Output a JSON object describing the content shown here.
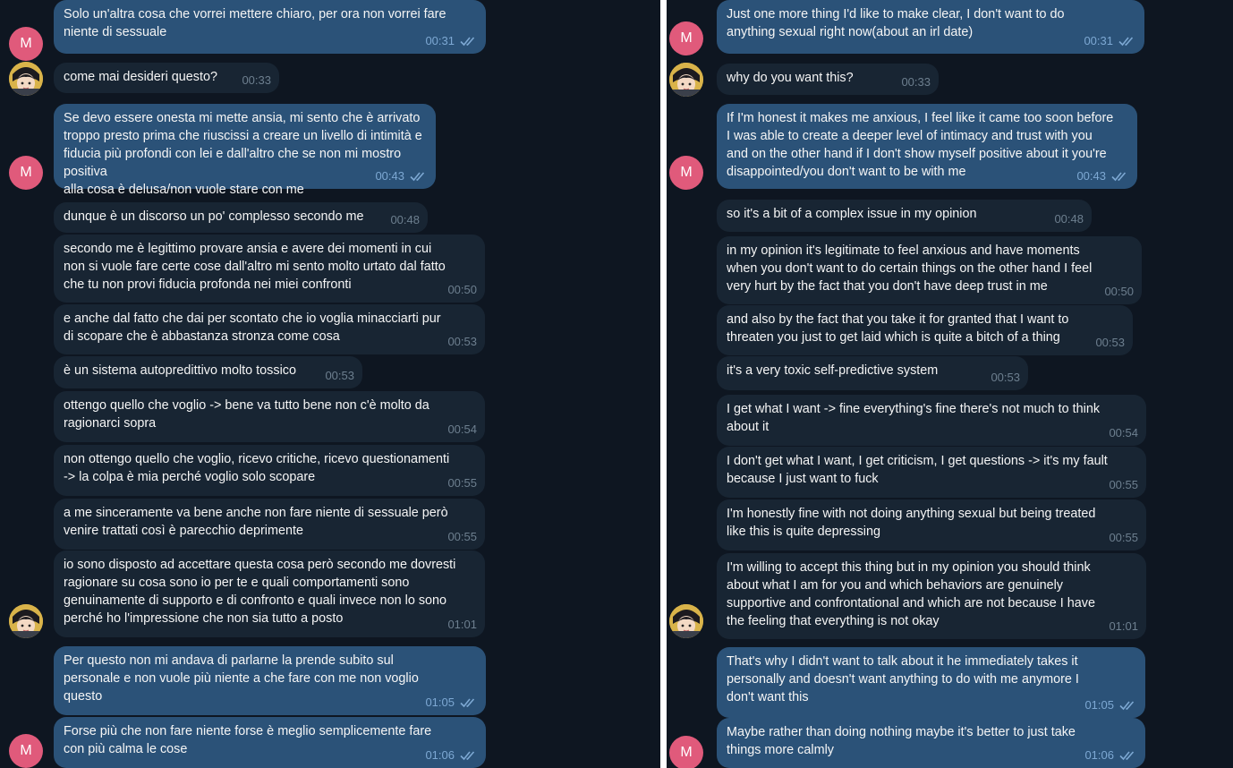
{
  "italian": {
    "messages": [
      {
        "dir": "out",
        "text": "Solo un'altra cosa che vorrei mettere chiaro, per ora non vorrei fare\nniente di sessuale",
        "time": "00:31"
      },
      {
        "dir": "in",
        "text": "come mai desideri questo?",
        "time": "00:33"
      },
      {
        "dir": "out",
        "text": "Se devo essere onesta mi mette ansia, mi sento che è arrivato\ntroppo presto prima che riuscissi a creare un livello di intimità e\nfiducia più profondi con lei e dall'altro che se non mi mostro positiva\nalla cosa è delusa/non vuole stare con me",
        "time": "00:43"
      },
      {
        "dir": "in",
        "text": "dunque è un discorso un po' complesso secondo me",
        "time": "00:48"
      },
      {
        "dir": "in",
        "text": "secondo me è legittimo provare ansia e avere dei momenti in cui\nnon si vuole fare certe cose dall'altro mi sento molto urtato dal fatto\nche tu non provi fiducia profonda nei miei confronti",
        "time": "00:50"
      },
      {
        "dir": "in",
        "text": "e anche dal fatto che dai per scontato che io voglia minacciarti pur\ndi scopare che è abbastanza stronza come cosa",
        "time": "00:53"
      },
      {
        "dir": "in",
        "text": "è un sistema autopredittivo molto tossico",
        "time": "00:53"
      },
      {
        "dir": "in",
        "text": "ottengo quello che voglio -> bene va tutto bene non c'è molto da\nragionarci sopra",
        "time": "00:54"
      },
      {
        "dir": "in",
        "text": "non ottengo quello che voglio, ricevo critiche, ricevo questionamenti\n-> la colpa è mia perché voglio solo scopare",
        "time": "00:55"
      },
      {
        "dir": "in",
        "text": "a me sinceramente va bene anche non fare niente di sessuale però\nvenire trattati così è parecchio deprimente",
        "time": "00:55"
      },
      {
        "dir": "in",
        "text": "io sono disposto ad accettare questa cosa però secondo me dovresti\nragionare su cosa sono io per te e quali comportamenti sono\ngenuinamente di supporto e di confronto e quali invece non lo sono\nperché ho l'impressione che non sia tutto a posto",
        "time": "01:01"
      },
      {
        "dir": "out",
        "text": "Per questo non mi andava di parlarne la prende subito sul\npersonale e non vuole più niente a che fare con me non voglio\nquesto",
        "time": "01:05"
      },
      {
        "dir": "out",
        "text": "Forse più che non fare niente forse è meglio semplicemente fare\ncon più calma le cose",
        "time": "01:06"
      }
    ]
  },
  "english": {
    "messages": [
      {
        "dir": "out",
        "text": "Just one more thing I'd like to make clear, I don't want to do\nanything sexual right now(about an irl date)",
        "time": "00:31"
      },
      {
        "dir": "in",
        "text": "why do you want this?",
        "time": "00:33"
      },
      {
        "dir": "out",
        "text": "If I'm honest it makes me anxious, I feel like it came too soon before\nI was able to create a deeper level of intimacy and trust with you\nand on the other hand if I don't show myself positive about it you're\ndisappointed/you don't want to be with me",
        "time": "00:43"
      },
      {
        "dir": "in",
        "text": "so it's a bit of a complex issue in my opinion",
        "time": "00:48"
      },
      {
        "dir": "in",
        "text": "in my opinion it's legitimate to feel anxious and have moments\nwhen you don't want to do certain things on the other hand I feel\nvery hurt by the fact that you don't have deep trust in me",
        "time": "00:50"
      },
      {
        "dir": "in",
        "text": "and also by the fact that you take it for granted that I want to\nthreaten you just to get laid which is quite a bitch of a thing",
        "time": "00:53"
      },
      {
        "dir": "in",
        "text": "it's a very toxic self-predictive system",
        "time": "00:53"
      },
      {
        "dir": "in",
        "text": "I get what I want -> fine everything's fine there's not much to think\nabout it",
        "time": "00:54"
      },
      {
        "dir": "in",
        "text": "I don't get what I want, I get criticism, I get questions -> it's my fault\nbecause I just want to fuck",
        "time": "00:55"
      },
      {
        "dir": "in",
        "text": "I'm honestly fine with not doing anything sexual but being treated\nlike this is quite depressing",
        "time": "00:55"
      },
      {
        "dir": "in",
        "text": "I'm willing to accept this thing but in my opinion you should think\nabout what I am for you and which behaviors are genuinely\nsupportive and confrontational and which are not because I have\nthe feeling that everything is not okay",
        "time": "01:01"
      },
      {
        "dir": "out",
        "text": "That's why I didn't want to talk about it he immediately takes it\npersonally and doesn't want anything to do with me anymore I\ndon't want this",
        "time": "01:05"
      },
      {
        "dir": "out",
        "text": "Maybe rather than doing nothing maybe it's better to just take\nthings more calmly",
        "time": "01:06"
      }
    ]
  },
  "avatars": {
    "self_initial": "M"
  },
  "colors": {
    "background": "#0e1621",
    "incoming": "#182533",
    "outgoing": "#2b5278",
    "avatar_m": "#e05a7b",
    "time_out": "#7da8d3",
    "time_in": "#6d7f8f"
  }
}
